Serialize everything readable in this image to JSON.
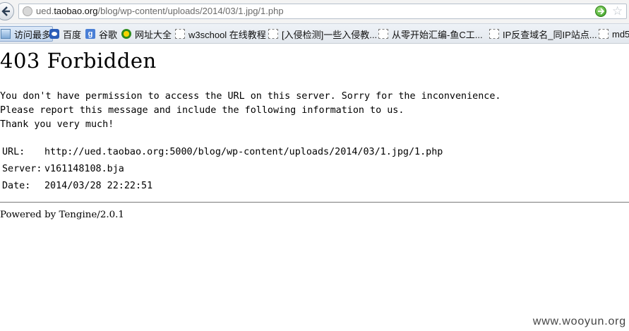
{
  "browser": {
    "url_prefix": "ued.",
    "url_domain": "taobao.org",
    "url_path": "/blog/wp-content/uploads/2014/03/1.jpg/1.php",
    "icons": {
      "back": "back-arrow-icon",
      "site": "site-globe-icon",
      "go": "go-arrow-icon",
      "bookmark": "star-icon"
    }
  },
  "bookmarks": [
    {
      "label": "访问最多",
      "icon": "folder-icon"
    },
    {
      "label": "百度",
      "icon": "baidu-paw-icon"
    },
    {
      "label": "谷歌",
      "icon": "google-g-icon"
    },
    {
      "label": "网址大全",
      "icon": "nav-globe-icon"
    },
    {
      "label": "w3school 在线教程",
      "icon": "page-icon"
    },
    {
      "label": "[入侵检测]一些入侵教...",
      "icon": "page-icon"
    },
    {
      "label": "从零开始汇编-鱼C工...",
      "icon": "page-icon"
    },
    {
      "label": "IP反查域名_同IP站点...",
      "icon": "page-icon"
    },
    {
      "label": "md5",
      "icon": "page-icon"
    }
  ],
  "page": {
    "title": "403 Forbidden",
    "message_lines": [
      "You don't have permission to access the URL on this server. Sorry for the inconvenience.",
      "Please report this message and include the following information to us.",
      "Thank you very much!"
    ],
    "info": {
      "url_label": "URL:",
      "url_value": "http://ued.taobao.org:5000/blog/wp-content/uploads/2014/03/1.jpg/1.php",
      "server_label": "Server:",
      "server_value": "v161148108.bja",
      "date_label": "Date:",
      "date_value": "2014/03/28 22:22:51"
    },
    "powered_by": "Powered by Tengine/2.0.1"
  },
  "watermark": "www.wooyun.org"
}
